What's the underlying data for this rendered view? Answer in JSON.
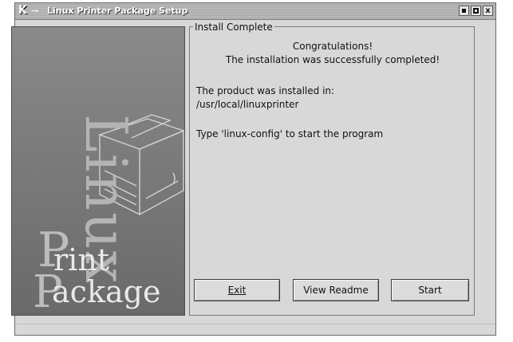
{
  "window": {
    "title": "Linux Printer Package Setup",
    "controls": {
      "minimize": "minimize",
      "maximize": "maximize",
      "close": "x"
    }
  },
  "sidebar": {
    "vertical_word": "Linux",
    "print_big": "P",
    "print_word": "rint",
    "package_big": "P",
    "package_word": "ackage"
  },
  "panel": {
    "legend": "Install Complete",
    "congrats": "Congratulations!",
    "success": "The installation was successfully completed!",
    "installed_in_label": "The product was installed in:",
    "install_path": "/usr/local/linuxprinter",
    "start_hint": "Type 'linux-config' to start the program"
  },
  "buttons": {
    "exit": "Exit",
    "view_readme": "View Readme",
    "start": "Start"
  },
  "colors": {
    "window_bg": "#d8d8d8",
    "titlebar": "#b0b0b0",
    "sidebar_bg": "#7b7b7b"
  }
}
